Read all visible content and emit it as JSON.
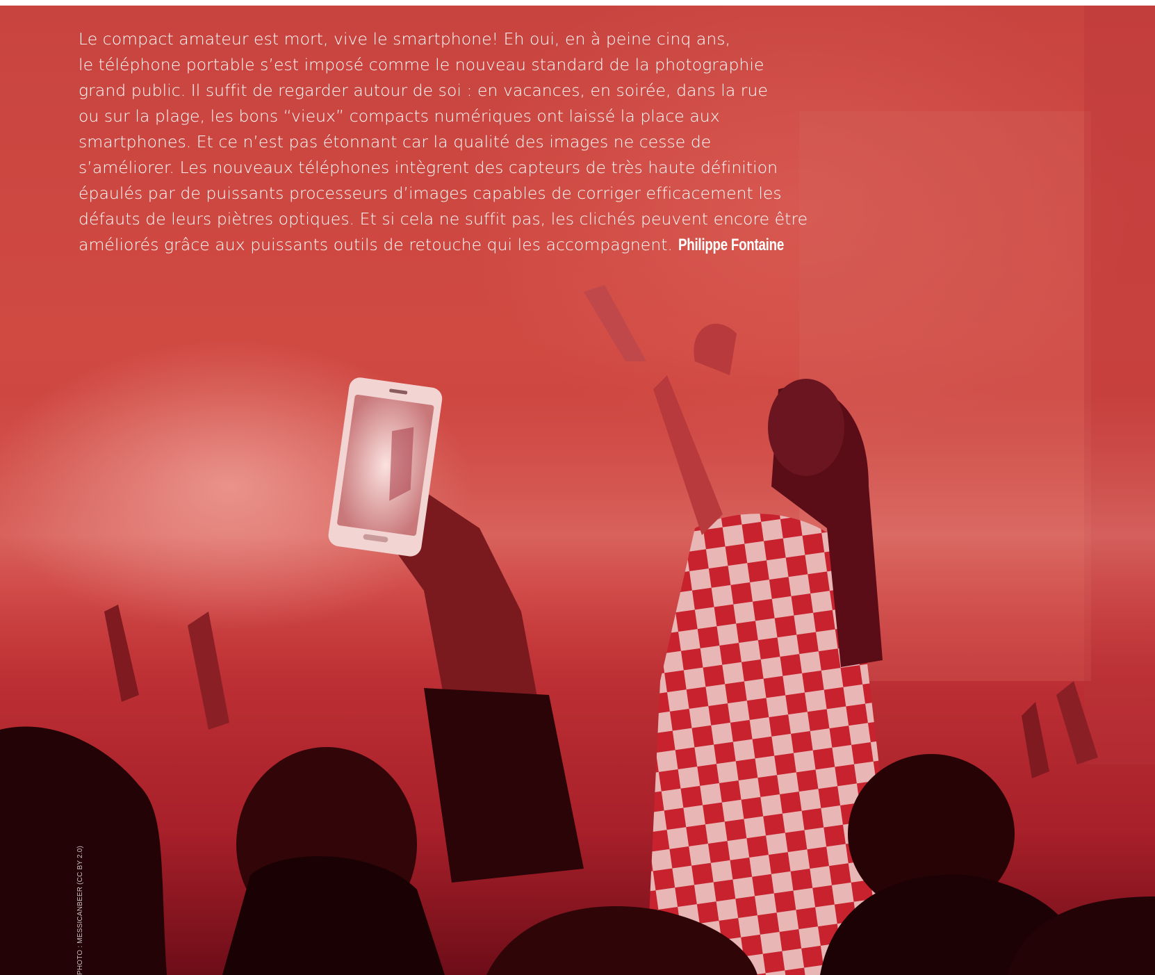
{
  "intro": {
    "lines": [
      "Le compact amateur est mort, vive le smartphone! Eh oui, en à peine cinq ans,",
      "le téléphone portable s’est imposé comme le nouveau standard de la photographie",
      "grand public. Il suffit de regarder autour de soi : en vacances, en soirée, dans la rue",
      "ou sur la plage, les bons “vieux” compacts numériques ont laissé la place aux",
      "smartphones. Et ce n’est pas étonnant car la qualité des images ne cesse de",
      "s’améliorer. Les nouveaux téléphones intègrent des capteurs de très haute définition",
      "épaulés par de puissants processeurs d’images capables de corriger efficacement les",
      "défauts de leurs piètres optiques. Et si cela ne suffit pas, les clichés peuvent encore être",
      "améliorés grâce aux puissants outils de retouche qui les accompagnent."
    ],
    "author": "Philippe Fontaine"
  },
  "photo_credit": "PHOTO : MESSICANBEER (CC BY 2.0)",
  "colors": {
    "background_red": "#c8443f",
    "text": "#ffffff"
  }
}
